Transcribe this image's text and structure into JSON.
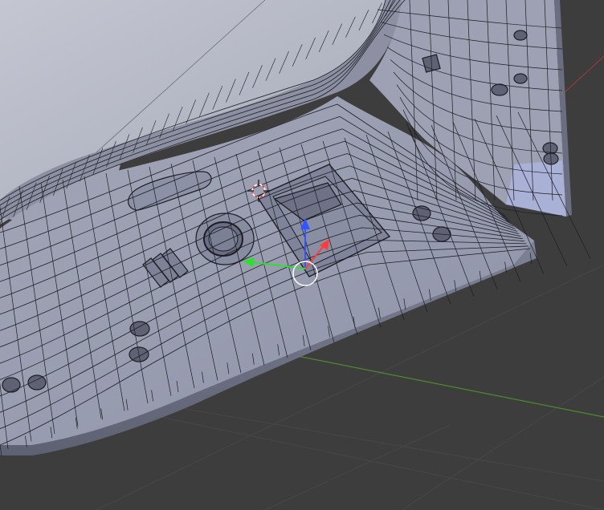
{
  "viewport": {
    "mode": "edit-mode-wireframe-overlay",
    "shading": "solid",
    "colors": {
      "background": "#3d3d3d",
      "grid_line": "#4a4a4a",
      "x_axis": "#8e3a3a",
      "y_axis": "#4f8a2e",
      "mesh_face": "#9a9eb0",
      "mesh_face_light": "#b8bbc8",
      "mesh_face_dark": "#6f7286",
      "wire": "#1c1d24",
      "gizmo_x": "#ff3b3b",
      "gizmo_y": "#2ee02e",
      "gizmo_z": "#3355ff"
    },
    "icons": {
      "cursor": "3d-cursor-icon",
      "manipulator": "transform-manipulator-icon"
    }
  }
}
